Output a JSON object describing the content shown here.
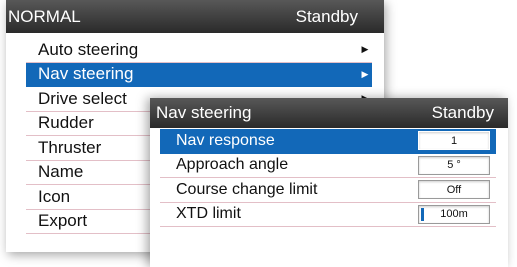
{
  "menu": {
    "title": "NORMAL",
    "status": "Standby",
    "items": [
      {
        "label": "Auto steering",
        "arrow": "▶"
      },
      {
        "label": "Nav steering",
        "arrow": "▶"
      },
      {
        "label": "Drive select",
        "arrow": "▶"
      },
      {
        "label": "Rudder",
        "arrow": ""
      },
      {
        "label": "Thruster",
        "arrow": ""
      },
      {
        "label": "Name",
        "arrow": ""
      },
      {
        "label": "Icon",
        "arrow": ""
      },
      {
        "label": "Export",
        "arrow": ""
      }
    ],
    "selected_index": 1
  },
  "submenu": {
    "title": "Nav steering",
    "status": "Standby",
    "items": [
      {
        "label": "Nav response",
        "value": "1"
      },
      {
        "label": "Approach angle",
        "value": "5 °"
      },
      {
        "label": "Course change limit",
        "value": "Off"
      },
      {
        "label": "XTD limit",
        "value": "100m",
        "level_fraction": 0.04
      }
    ],
    "selected_index": 0
  },
  "colors": {
    "selection": "#1268b8",
    "titlebar": "#3a3a3a",
    "divider": "#e3bfc7"
  }
}
